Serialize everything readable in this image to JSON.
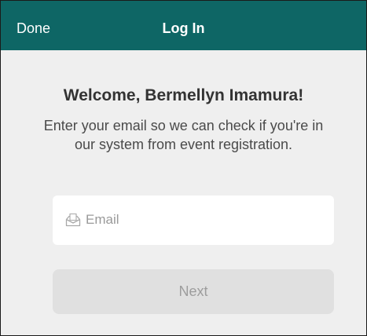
{
  "nav": {
    "done_label": "Done",
    "title": "Log In",
    "background_color": "#0e6665"
  },
  "welcome": {
    "heading": "Welcome, Bermellyn Imamura!",
    "description": "Enter your email so we can check if you're in our system from event registration."
  },
  "form": {
    "email": {
      "icon": "envelope-icon",
      "placeholder": "Email",
      "value": ""
    },
    "next_label": "Next",
    "next_disabled": true
  }
}
